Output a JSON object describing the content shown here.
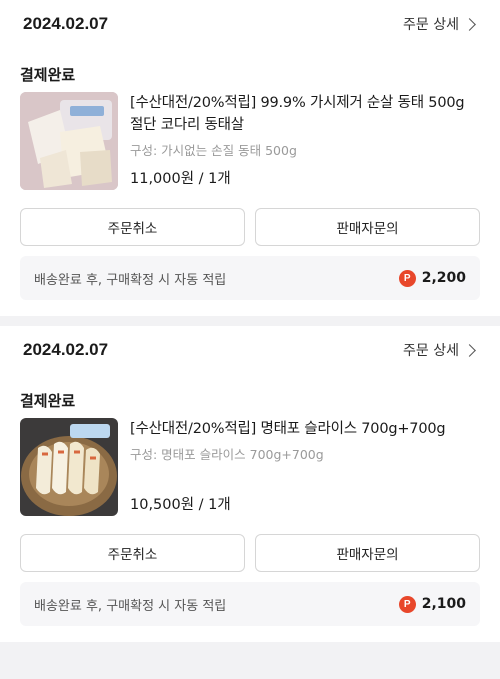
{
  "orders": [
    {
      "date": "2024.02.07",
      "detail_label": "주문 상세",
      "status": "결제완료",
      "product_name": "[수산대전/20%적립] 99.9% 가시제거 순살 동태 500g 절단 코다리 동태살",
      "option": "구성: 가시없는 손질 동태 500g",
      "price": "11,000원 / 1개",
      "cancel_label": "주문취소",
      "inquiry_label": "판매자문의",
      "reward_text": "배송완료 후, 구매확정 시 자동 적립",
      "reward_points": "2,200",
      "thumbnail": "fish-fillet-image"
    },
    {
      "date": "2024.02.07",
      "detail_label": "주문 상세",
      "status": "결제완료",
      "product_name": "[수산대전/20%적립] 명태포 슬라이스 700g+700g",
      "option": "구성: 명태포 슬라이스 700g+700g",
      "price": "10,500원 / 1개",
      "cancel_label": "주문취소",
      "inquiry_label": "판매자문의",
      "reward_text": "배송완료 후, 구매확정 시 자동 적립",
      "reward_points": "2,100",
      "thumbnail": "pollack-slices-image"
    }
  ],
  "icons": {
    "points": "P",
    "points_color": "#e8472b",
    "chevron": "chevron-right-icon"
  }
}
